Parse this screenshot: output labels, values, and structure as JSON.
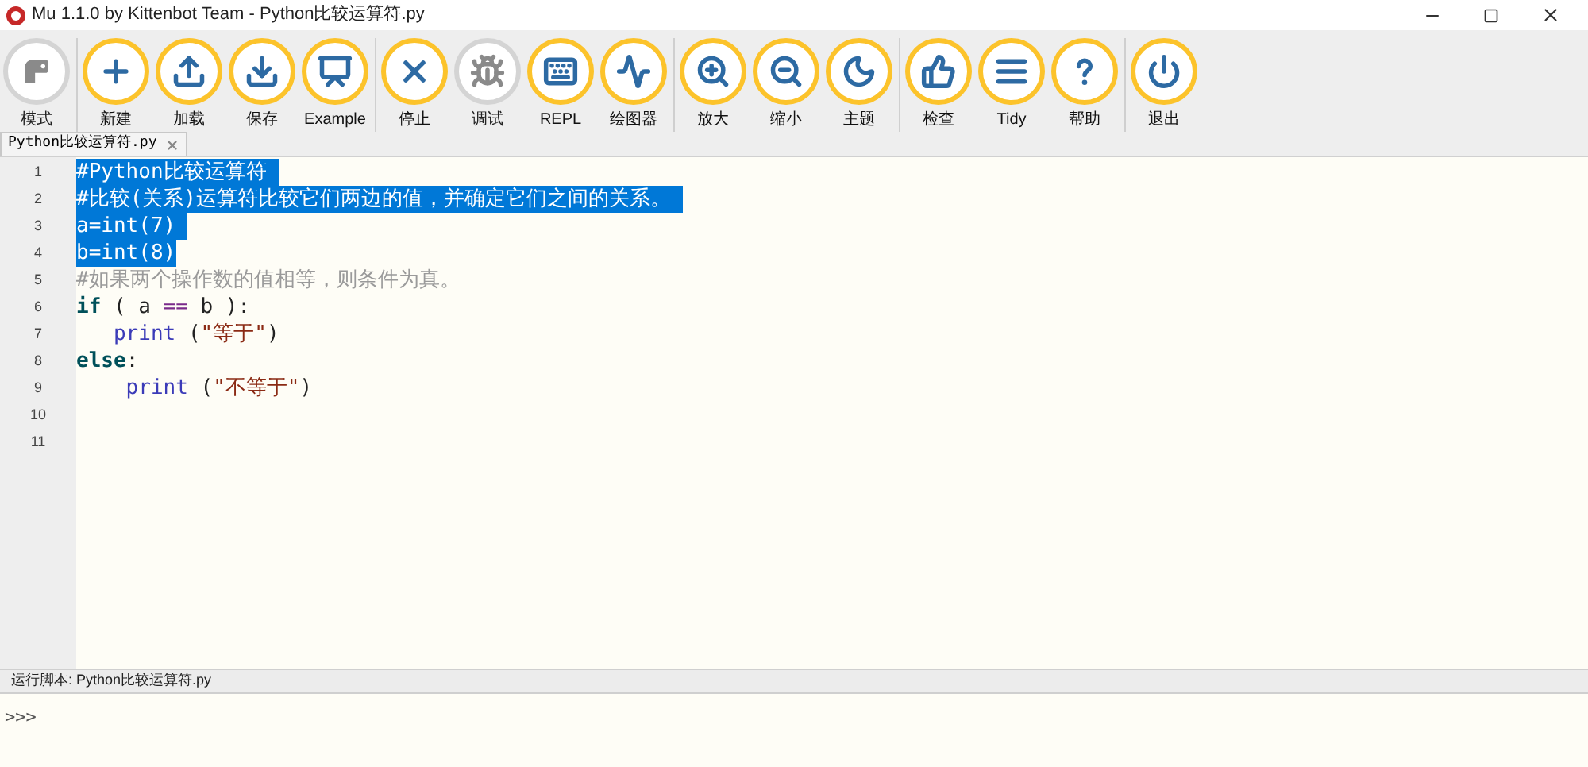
{
  "window": {
    "title": "Mu 1.1.0 by Kittenbot Team - Python比较运算符.py"
  },
  "toolbar": {
    "groups": [
      [
        {
          "label": "模式",
          "disabled": true
        }
      ],
      [
        {
          "label": "新建",
          "disabled": false
        },
        {
          "label": "加载",
          "disabled": false
        },
        {
          "label": "保存",
          "disabled": false
        },
        {
          "label": "Example",
          "disabled": false
        }
      ],
      [
        {
          "label": "停止",
          "disabled": false
        },
        {
          "label": "调试",
          "disabled": true
        },
        {
          "label": "REPL",
          "disabled": false
        },
        {
          "label": "绘图器",
          "disabled": false
        }
      ],
      [
        {
          "label": "放大",
          "disabled": false
        },
        {
          "label": "缩小",
          "disabled": false
        },
        {
          "label": "主题",
          "disabled": false
        }
      ],
      [
        {
          "label": "检查",
          "disabled": false
        },
        {
          "label": "Tidy",
          "disabled": false
        },
        {
          "label": "帮助",
          "disabled": false
        }
      ],
      [
        {
          "label": "退出",
          "disabled": false
        }
      ]
    ]
  },
  "tabs": [
    {
      "label": "Python比较运算符.py",
      "selected": true
    }
  ],
  "editor": {
    "lines": [
      {
        "number": "1",
        "selected": true,
        "tokens": [
          {
            "kind": "comment",
            "text": "#Python比较运算符 "
          }
        ]
      },
      {
        "number": "2",
        "selected": true,
        "tokens": [
          {
            "kind": "comment",
            "text": "#比较(关系)运算符比较它们两边的值，并确定它们之间的关系。 "
          }
        ]
      },
      {
        "number": "3",
        "selected": true,
        "tokens": [
          {
            "kind": "plain",
            "text": "a=int(7) "
          }
        ]
      },
      {
        "number": "4",
        "selected": true,
        "tokens": [
          {
            "kind": "plain",
            "text": "b=int(8)"
          }
        ]
      },
      {
        "number": "5",
        "selected": false,
        "tokens": [
          {
            "kind": "comment",
            "text": "#如果两个操作数的值相等，则条件为真。"
          }
        ]
      },
      {
        "number": "6",
        "selected": false,
        "tokens": [
          {
            "kind": "keyword",
            "text": "if"
          },
          {
            "kind": "plain",
            "text": " ( a "
          },
          {
            "kind": "operator",
            "text": "=="
          },
          {
            "kind": "plain",
            "text": " b ):"
          }
        ]
      },
      {
        "number": "7",
        "selected": false,
        "tokens": [
          {
            "kind": "builtin",
            "text": "   print"
          },
          {
            "kind": "plain",
            "text": " ("
          },
          {
            "kind": "string",
            "text": "\"等于\""
          },
          {
            "kind": "plain",
            "text": ")"
          }
        ]
      },
      {
        "number": "8",
        "selected": false,
        "tokens": [
          {
            "kind": "keyword",
            "text": "else"
          },
          {
            "kind": "plain",
            "text": ":"
          }
        ]
      },
      {
        "number": "9",
        "selected": false,
        "tokens": [
          {
            "kind": "builtin",
            "text": "    print"
          },
          {
            "kind": "plain",
            "text": " ("
          },
          {
            "kind": "string",
            "text": "\"不等于\""
          },
          {
            "kind": "plain",
            "text": ")"
          }
        ]
      },
      {
        "number": "10"
      },
      {
        "number": "11"
      }
    ]
  },
  "status_bar": {
    "text": "运行脚本: Python比较运算符.py"
  },
  "repl": {
    "prompt": ">>>"
  }
}
